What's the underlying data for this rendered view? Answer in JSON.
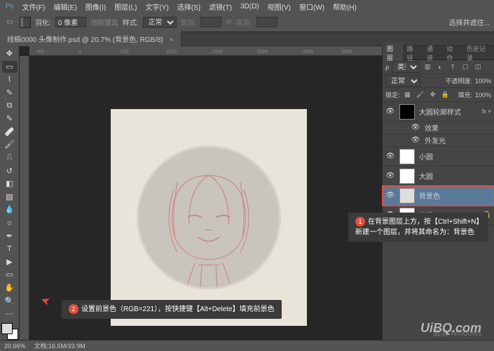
{
  "menu": [
    "文件(F)",
    "编辑(E)",
    "图像(I)",
    "图层(L)",
    "文字(Y)",
    "选择(S)",
    "滤镜(T)",
    "3D(D)",
    "视图(V)",
    "窗口(W)",
    "帮助(H)"
  ],
  "options": {
    "feather_label": "羽化:",
    "feather_val": "0 像素",
    "antialias": "消除锯齿",
    "style_label": "样式:",
    "style_val": "正常",
    "width_label": "宽度:",
    "height_label": "高度:",
    "select_mask": "选择并遮住..."
  },
  "doc_tab": "线稿0000 头像制作.psd @ 20.7% (背景色, RGB/8)",
  "ruler_marks": [
    "500",
    "0",
    "500",
    "1000",
    "1500",
    "2000",
    "2500",
    "2800"
  ],
  "panel_tabs": [
    "图层",
    "路径",
    "通道",
    "动作",
    "历史记录"
  ],
  "layer_filter": "类型",
  "blend_mode": "正常",
  "opacity_label": "不透明度:",
  "opacity_val": "100%",
  "lock_label": "锁定:",
  "fill_label": "填充:",
  "fill_val": "100%",
  "layers": [
    {
      "name": "大圆轮廓样式",
      "fx": true
    },
    {
      "name": "效果",
      "indent": true
    },
    {
      "name": "外发光",
      "indent": true
    },
    {
      "name": "小圆"
    },
    {
      "name": "大圆"
    },
    {
      "name": "背景色",
      "selected": true
    },
    {
      "name": "背景",
      "locked": true
    }
  ],
  "annotation1": {
    "num": "1",
    "text": "在背景图层上方，按【Ctrl+Shift+N】新建一个图层，并将其命名为：背景色"
  },
  "annotation2": {
    "num": "2",
    "text": "设置前景色（RGB=221），按快捷键【Alt+Delete】填充前景色"
  },
  "status": {
    "zoom": "20.66%",
    "doc_label": "文档:",
    "doc_val": "16.5M/33.9M"
  },
  "watermark": "UiBQ.com",
  "activate": "激活 Windows",
  "colors": {
    "fg": "#dddddd",
    "bg": "#ffffff"
  }
}
